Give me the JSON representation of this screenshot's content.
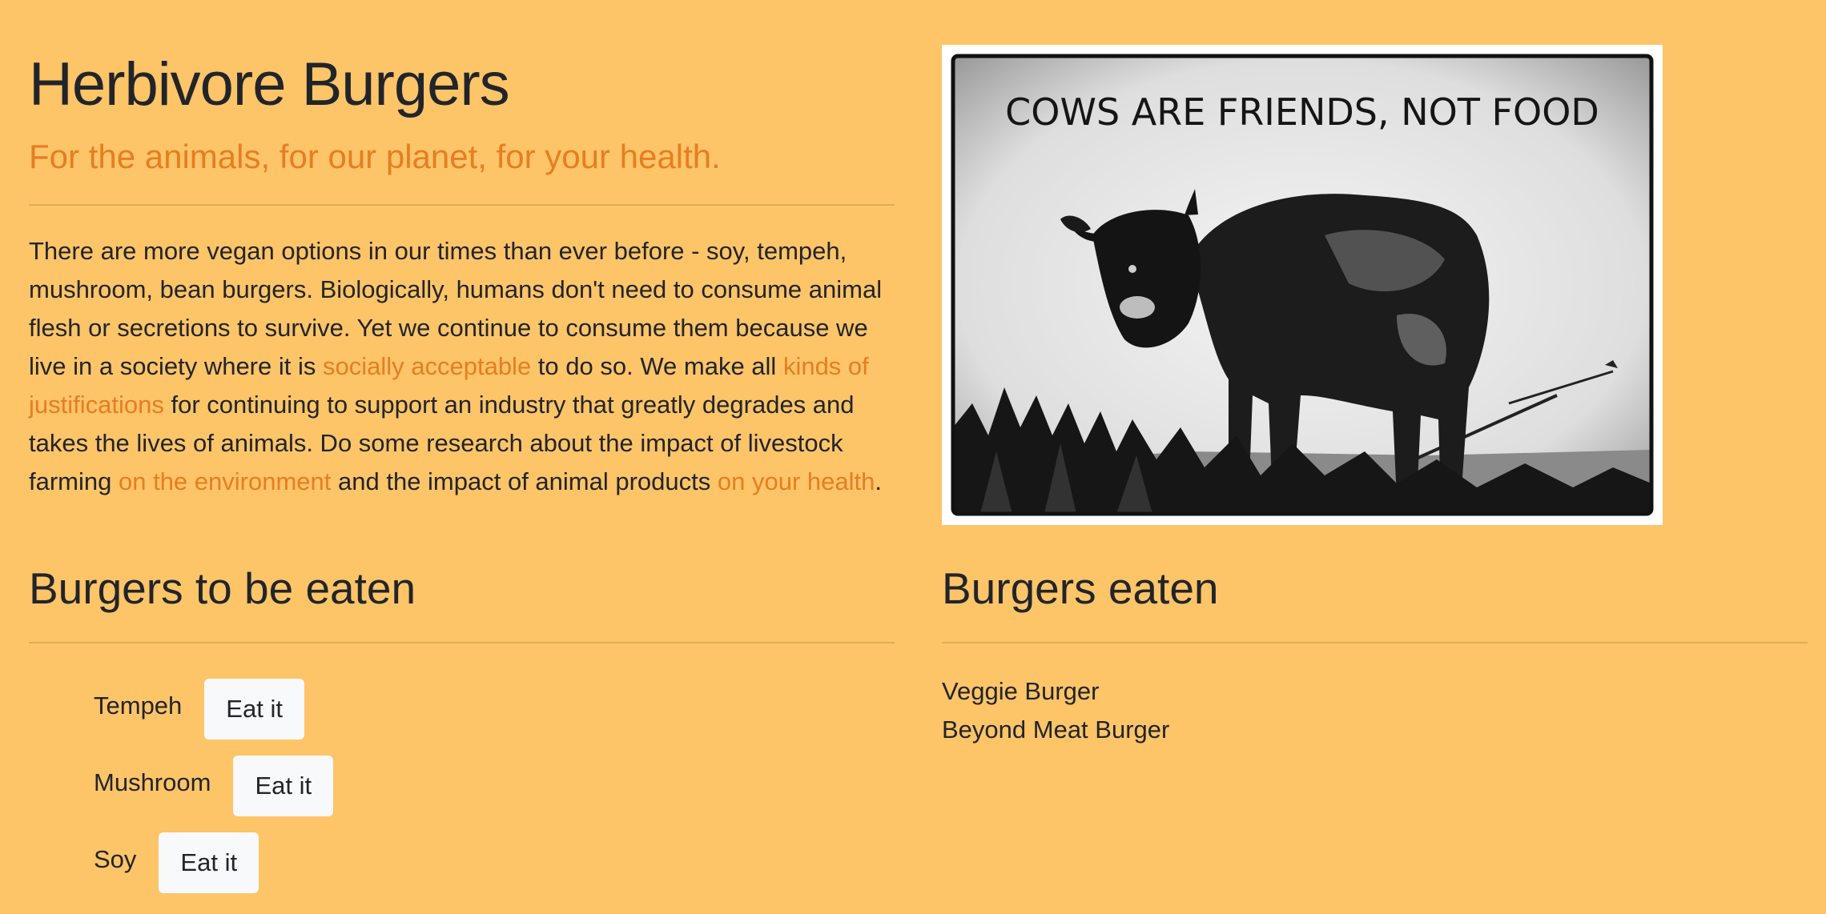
{
  "header": {
    "title": "Herbivore Burgers",
    "tagline": "For the animals, for our planet, for your health."
  },
  "intro": {
    "part1": "There are more vegan options in our times than ever before - soy, tempeh, mushroom, bean burgers. Biologically, humans don't need to consume animal flesh or secretions to survive. Yet we continue to consume them because we live in a society where it is ",
    "link1": "socially acceptable",
    "part2": " to do so. We make all ",
    "link2": "kinds of justifications",
    "part3": " for continuing to support an industry that greatly degrades and takes the lives of animals. Do some research about the impact of livestock farming ",
    "link3": "on the environment",
    "part4": " and the impact of animal products ",
    "link4": "on your health",
    "part5": "."
  },
  "image": {
    "caption": "COWS ARE FRIENDS, NOT FOOD"
  },
  "to_eat": {
    "heading": "Burgers to be eaten",
    "button_label": "Eat it",
    "items": [
      {
        "name": "Tempeh"
      },
      {
        "name": "Mushroom"
      },
      {
        "name": "Soy"
      }
    ]
  },
  "eaten": {
    "heading": "Burgers eaten",
    "items": [
      {
        "name": "Veggie Burger"
      },
      {
        "name": "Beyond Meat Burger"
      }
    ]
  },
  "colors": {
    "background": "#fec468",
    "accent": "#e67e22",
    "text": "#212529",
    "button": "#f8f9fa"
  }
}
